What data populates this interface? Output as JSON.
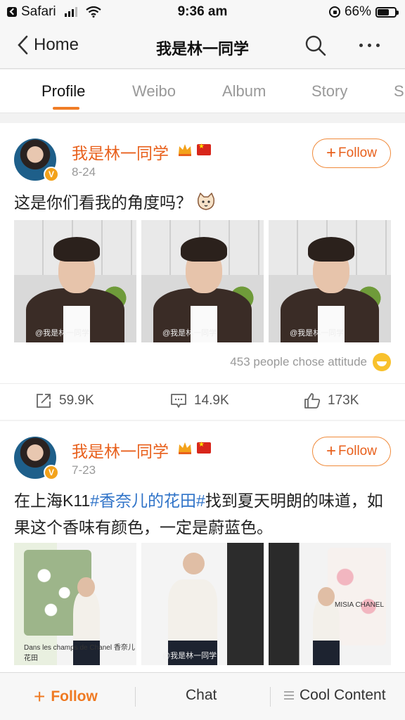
{
  "status_bar": {
    "back_app": "Safari",
    "time": "9:36 am",
    "battery": "66%",
    "battery_level": 0.66
  },
  "nav": {
    "back_label": "Home",
    "title": "我是林一同学"
  },
  "tabs": [
    {
      "label": "Profile",
      "active": true
    },
    {
      "label": "Weibo",
      "active": false
    },
    {
      "label": "Album",
      "active": false
    },
    {
      "label": "Story",
      "active": false
    },
    {
      "label": "S",
      "active": false
    }
  ],
  "posts": [
    {
      "user_name": "我是林一同学",
      "date": "8-24",
      "follow_label": "Follow",
      "text": "这是你们看我的角度吗？",
      "photo_captions": [
        "@我是林一同学",
        "@我是林一同学",
        "@我是林一同学"
      ],
      "attitude": "453 people chose attitude",
      "actions": {
        "repost": "59.9K",
        "comment": "14.9K",
        "like": "173K"
      }
    },
    {
      "user_name": "我是林一同学",
      "date": "7-23",
      "follow_label": "Follow",
      "text_parts": [
        "在上海K11",
        "#香奈儿的花田#",
        "找到夏天明朗的味道，如果这个香味有颜色，一定是蔚蓝色。"
      ],
      "photo_captions": [
        "Dans les champs de Chanel 香奈儿花田",
        "@我是林一同学",
        "MISIA CHANEL"
      ]
    }
  ],
  "bottom_bar": {
    "follow_label": "Follow",
    "chat_label": "Chat",
    "cool_label": "Cool Content"
  },
  "colors": {
    "accent": "#ef7a23",
    "name": "#e8601c",
    "tag": "#2f73c8",
    "badge": "#f3a21b"
  }
}
